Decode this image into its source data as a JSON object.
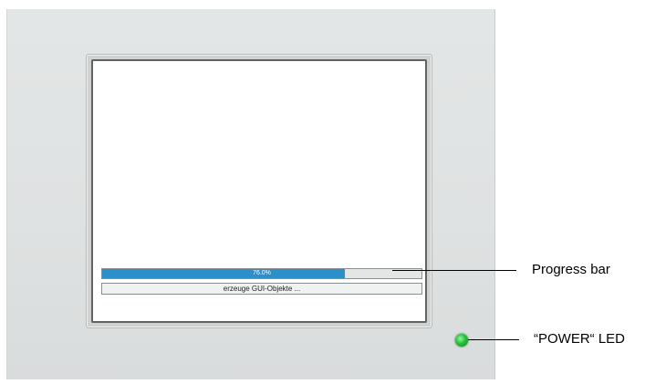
{
  "device": {
    "led_color": "#23c23b"
  },
  "screen": {
    "progress": {
      "value_fraction": 0.76,
      "label": "76.0%",
      "fill_color": "#2d8fc9"
    },
    "status_text": "erzeuge GUI-Objekte ..."
  },
  "callouts": {
    "progress_bar_label": "Progress bar",
    "power_led_label": "“POWER“ LED"
  }
}
